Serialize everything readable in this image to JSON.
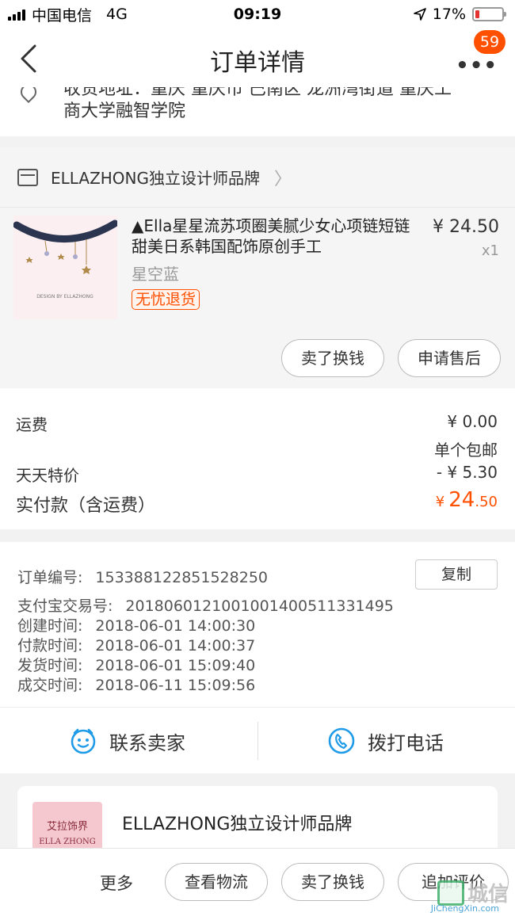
{
  "status_bar": {
    "carrier": "中国电信",
    "network": "4G",
    "time": "09:19",
    "battery_percent": "17%",
    "battery_level": 0.17,
    "battery_color": "#e3322f"
  },
  "nav": {
    "title": "订单详情",
    "back_icon": "chevron-left-icon",
    "more_icon": "more-dots-icon",
    "more_glyph": "•••",
    "badge_count": "59",
    "badge_color": "#ff5000"
  },
  "address": {
    "line1": "收货地址：重庆 重庆市 巴南区 龙洲湾街道 重庆工",
    "line2": "商大学融智学院"
  },
  "shop": {
    "name": "ELLAZHONG独立设计师品牌",
    "chevron": "〉"
  },
  "product": {
    "name": "▲Ella星星流苏项圈美腻少女心项链短链甜美日系韩国配饰原创手工",
    "price": "¥ 24.50",
    "quantity": "x1",
    "sku": "星空蓝",
    "tag": "无忧退货",
    "thumb_caption": "DESIGN BY ELLAZHONG",
    "buttons": {
      "sell": "卖了换钱",
      "aftersale": "申请售后"
    }
  },
  "fees": {
    "shipping_label": "运费",
    "shipping_value": "¥ 0.00",
    "shipping_note": "单个包邮",
    "discount_label": "天天特价",
    "discount_value": "- ¥ 5.30",
    "total_label": "实付款（含运费）",
    "total_currency": "¥",
    "total_integer": "24",
    "total_decimal": ".50",
    "accent_color": "#ff5000"
  },
  "order_info": {
    "copy_label": "复制",
    "rows": [
      {
        "label": "订单编号:",
        "value": "153388122851528250"
      },
      {
        "label": "支付宝交易号:",
        "value": "2018060121001001400511331495"
      },
      {
        "label": "创建时间:",
        "value": "2018-06-01 14:00:30"
      },
      {
        "label": "付款时间:",
        "value": "2018-06-01 14:00:37"
      },
      {
        "label": "发货时间:",
        "value": "2018-06-01 15:09:40"
      },
      {
        "label": "成交时间:",
        "value": "2018-06-11 15:09:56"
      }
    ]
  },
  "contact": {
    "seller_label": "联系卖家",
    "seller_icon": "chat-face-icon",
    "phone_label": "拨打电话",
    "phone_icon": "phone-icon",
    "icon_color": "#1f9be8"
  },
  "recommend": {
    "logo_cn": "艾拉饰界",
    "logo_en": "ELLA ZHONG",
    "shop_name": "ELLAZHONG独立设计师品牌"
  },
  "bottom_bar": {
    "more_label": "更多",
    "logistics_label": "查看物流",
    "sell_label": "卖了换钱",
    "review_label": "追加评价"
  },
  "watermark": {
    "text": "城信",
    "url": "JiChengXin.com"
  }
}
